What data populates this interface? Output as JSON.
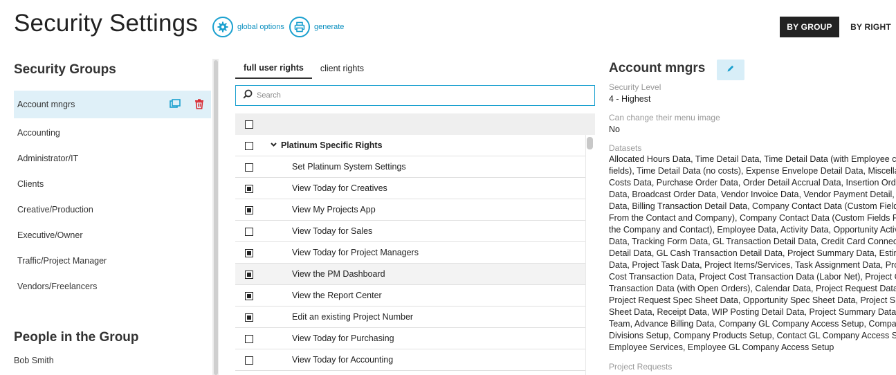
{
  "header": {
    "title": "Security Settings",
    "global_options_label": "global options",
    "generate_label": "generate",
    "by_group_label": "BY GROUP",
    "by_right_label": "BY RIGHT"
  },
  "sidebar": {
    "title": "Security Groups",
    "groups": [
      {
        "label": "Account mngrs",
        "selected": true
      },
      {
        "label": "Accounting"
      },
      {
        "label": "Administrator/IT"
      },
      {
        "label": "Clients"
      },
      {
        "label": "Creative/Production"
      },
      {
        "label": "Executive/Owner"
      },
      {
        "label": "Traffic/Project Manager"
      },
      {
        "label": "Vendors/Freelancers"
      }
    ],
    "people_title": "People in the Group",
    "people": [
      "Bob Smith"
    ]
  },
  "tabs": [
    {
      "label": "full user rights",
      "active": true
    },
    {
      "label": "client rights",
      "active": false
    }
  ],
  "search": {
    "placeholder": "Search",
    "value": ""
  },
  "rights": [
    {
      "label": "Platinum Specific Rights",
      "group": true,
      "checked": false
    },
    {
      "label": "Set Platinum System Settings",
      "checked": false
    },
    {
      "label": "View Today for Creatives",
      "checked": true
    },
    {
      "label": "View My Projects App",
      "checked": true
    },
    {
      "label": "View Today for Sales",
      "checked": false
    },
    {
      "label": "View Today for Project Managers",
      "checked": true
    },
    {
      "label": "View the PM Dashboard",
      "checked": true
    },
    {
      "label": "View the Report Center",
      "checked": true
    },
    {
      "label": "Edit an existing Project Number",
      "checked": true
    },
    {
      "label": "View Today for Purchasing",
      "checked": false
    },
    {
      "label": "View Today for Accounting",
      "checked": false
    }
  ],
  "detail": {
    "title": "Account mngrs",
    "security_level_label": "Security Level",
    "security_level_value": "4 - Highest",
    "menu_image_label": "Can change their menu image",
    "menu_image_value": "No",
    "datasets_label": "Datasets",
    "datasets_lines": [
      "Allocated Hours Data, Time Detail Data, Time Detail Data (with Employee c",
      "fields), Time Detail Data (no costs), Expense Envelope Detail Data, Miscellan",
      "Costs Data, Purchase Order Data, Order Detail Accrual Data, Insertion Orde",
      "Data, Broadcast Order Data, Vendor Invoice Data, Vendor Payment Detail,",
      "Data, Billing Transaction Detail Data, Company Contact Data (Custom Field",
      "From the Contact and Company), Company Contact Data (Custom Fields Fr",
      "the Company and Contact), Employee Data, Activity Data, Opportunity Activ",
      "Data, Tracking Form Data, GL Transaction Detail Data, Credit Card Connect",
      "Detail Data, GL Cash Transaction Detail Data, Project Summary Data, Estim",
      "Data, Project Task Data, Project Items/Services, Task Assignment Data, Proj",
      "Cost Transaction Data, Project Cost Transaction Data (Labor Net), Project C",
      "Transaction Data (with Open Orders), Calendar Data, Project Request Data",
      "Project Request Spec Sheet Data, Opportunity Spec Sheet Data, Project Spe",
      "Sheet Data, Receipt Data, WIP Posting Detail Data, Project Summary Data w",
      "Team, Advance Billing Data, Company GL Company Access Setup, Compan",
      "Divisions Setup, Company Products Setup, Contact GL Company Access Se",
      "Employee Services, Employee GL Company Access Setup"
    ],
    "project_requests_label": "Project Requests"
  },
  "colors": {
    "accent": "#1aa0cf",
    "selected_row": "#dff0f8",
    "delete_red": "#d9262e"
  },
  "icons": [
    "gear-icon",
    "printer-icon",
    "copy-icon",
    "trash-icon",
    "search-icon",
    "chevron-down-icon",
    "pencil-icon"
  ]
}
